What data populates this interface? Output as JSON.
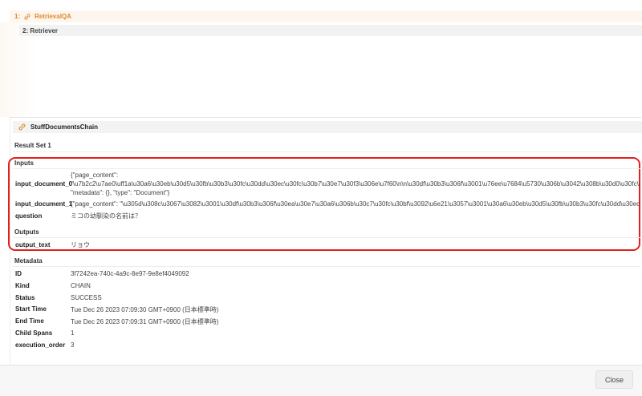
{
  "trace": {
    "root_prefix": "1:",
    "root_label": "RetrievalQA",
    "child_label": "2: Retriever"
  },
  "detail": {
    "chain_title": "StuffDocumentsChain",
    "result_set": "Result Set 1",
    "inputs_heading": "Inputs",
    "inputs": [
      {
        "key": "input_document_0",
        "lines": [
          "{\"page_content\":",
          "\"\\u7b2c2\\u7ae0\\uff1a\\u30a6\\u30eb\\u30d5\\u30fb\\u30b3\\u30fc\\u30dd\\u30ec\\u30fc\\u30b7\\u30e7\\u30f3\\u306e\\u7f60\\n\\n\\u30df\\u30b3\\u306f\\u3001\\u76ee\\u7684\\u5730\\u306b\\u3042\\u308b\\u30d0\\u30fc\\u300c\\u30b0\\u30",
          "\"metadata\": {}, \"type\": \"Document\"}"
        ]
      },
      {
        "key": "input_document_1",
        "value": "{\"page_content\": \"\\u305d\\u308c\\u3067\\u3082\\u3001\\u30df\\u30b3\\u306f\\u30ea\\u30e7\\u30a6\\u306b\\u30c7\\u30fc\\u30bf\\u3092\\u6e21\\u3057\\u3001\\u30a6\\u30eb\\u30d5\\u30fb\\u30b3\\u30fc\\u30dd\\u30ec\\u30fc\\u30b7\\u30e7"
      },
      {
        "key": "question",
        "value": "ミコの幼馴染の名前は？"
      }
    ],
    "outputs_heading": "Outputs",
    "outputs": [
      {
        "key": "output_text",
        "value": "リョウ"
      }
    ],
    "metadata_heading": "Metadata",
    "metadata": [
      {
        "key": "ID",
        "value": "3f7242ea-740c-4a9c-8e97-9e8ef4049092"
      },
      {
        "key": "Kind",
        "value": "CHAIN"
      },
      {
        "key": "Status",
        "value": "SUCCESS"
      },
      {
        "key": "Start Time",
        "value": "Tue Dec 26 2023 07:09:30 GMT+0900 (日本標準時)"
      },
      {
        "key": "End Time",
        "value": "Tue Dec 26 2023 07:09:31 GMT+0900 (日本標準時)"
      },
      {
        "key": "Child Spans",
        "value": "1"
      },
      {
        "key": "execution_order",
        "value": "3"
      }
    ]
  },
  "footer": {
    "close_label": "Close"
  },
  "colors": {
    "accent": "#e08a2a",
    "highlight": "#e3201b"
  }
}
